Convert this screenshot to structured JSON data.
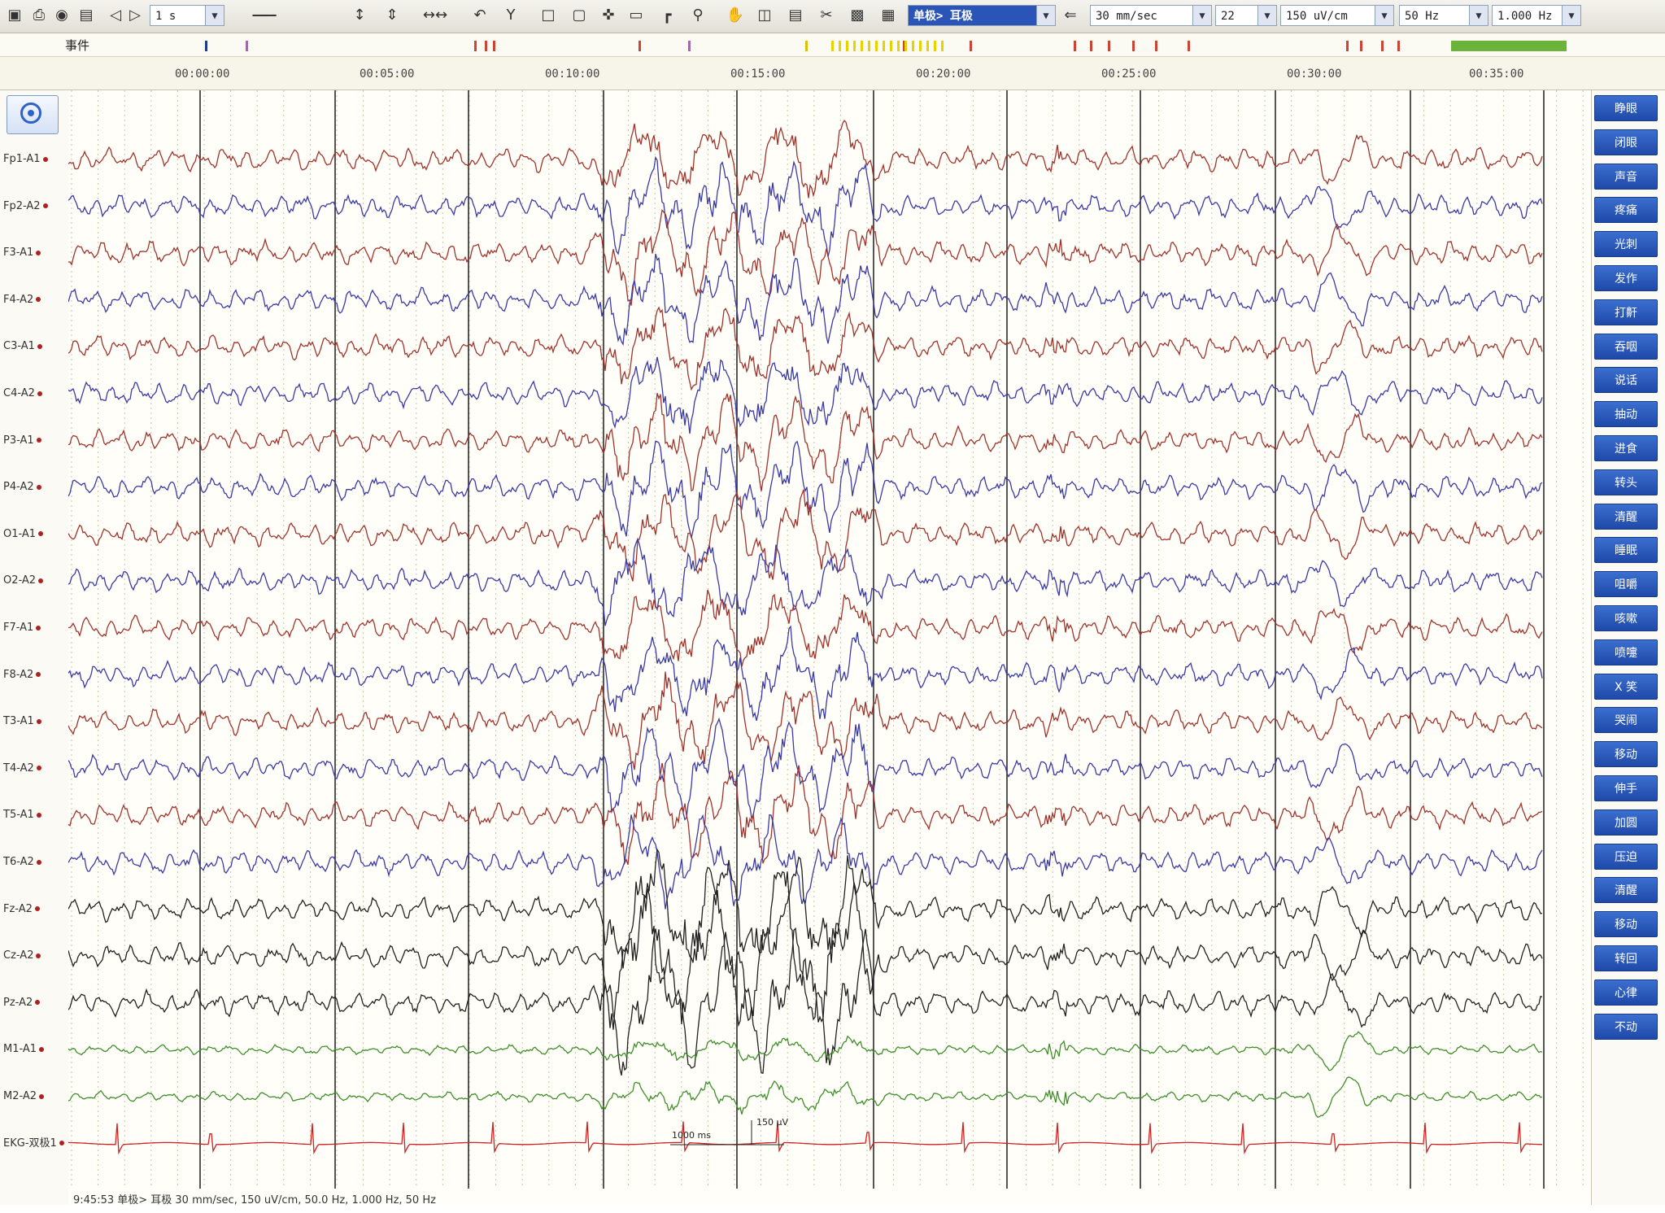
{
  "toolbar": {
    "icons": [
      "save-icon",
      "print-icon",
      "camera-icon",
      "archive-icon",
      "step-back-icon",
      "step-forward-icon",
      "zoom-slider-icon",
      "split-vertical-icon",
      "split-double-icon",
      "arrows-horizontal-icon",
      "undo-icon",
      "filter-y-icon",
      "select-icon",
      "box-icon",
      "crosshair-icon",
      "rect-icon",
      "corner-icon",
      "magnifier-icon",
      "hand-icon",
      "columns-icon",
      "rows-icon",
      "cut-icon",
      "image-icon",
      "window-icon"
    ],
    "page_value": "1 s",
    "montage": "单极> 耳极",
    "speed": "30 mm/sec",
    "channels": "22",
    "sensitivity": "150 uV/cm",
    "hf_filter": "50 Hz",
    "tc": "1.000 Hz"
  },
  "event_bar": {
    "label": "事件"
  },
  "timeline": {
    "ticks": [
      "00:00:00",
      "00:05:00",
      "00:10:00",
      "00:15:00",
      "00:20:00",
      "00:25:00",
      "00:30:00",
      "00:35:00"
    ]
  },
  "channels": [
    {
      "label": "Fp1-A1",
      "color": "#a0342c"
    },
    {
      "label": "Fp2-A2",
      "color": "#3a3aa8"
    },
    {
      "label": "F3-A1",
      "color": "#a0342c"
    },
    {
      "label": "F4-A2",
      "color": "#3a3aa8"
    },
    {
      "label": "C3-A1",
      "color": "#a0342c"
    },
    {
      "label": "C4-A2",
      "color": "#3a3aa8"
    },
    {
      "label": "P3-A1",
      "color": "#a0342c"
    },
    {
      "label": "P4-A2",
      "color": "#3a3aa8"
    },
    {
      "label": "O1-A1",
      "color": "#a0342c"
    },
    {
      "label": "O2-A2",
      "color": "#3a3aa8"
    },
    {
      "label": "F7-A1",
      "color": "#a0342c"
    },
    {
      "label": "F8-A2",
      "color": "#3a3aa8"
    },
    {
      "label": "T3-A1",
      "color": "#a0342c"
    },
    {
      "label": "T4-A2",
      "color": "#3a3aa8"
    },
    {
      "label": "T5-A1",
      "color": "#a0342c"
    },
    {
      "label": "T6-A2",
      "color": "#3a3aa8"
    },
    {
      "label": "Fz-A2",
      "color": "#222222"
    },
    {
      "label": "Cz-A2",
      "color": "#222222"
    },
    {
      "label": "Pz-A2",
      "color": "#222222"
    },
    {
      "label": "M1-A1",
      "color": "#3f8f2a"
    },
    {
      "label": "M2-A2",
      "color": "#3f8f2a"
    },
    {
      "label": "EKG-双极1",
      "color": "#d02020"
    }
  ],
  "event_buttons": [
    "睁眼",
    "闭眼",
    "声音",
    "疼痛",
    "光刺",
    "发作",
    "打鼾",
    "吞咽",
    "说话",
    "抽动",
    "进食",
    "转头",
    "清醒",
    "睡眠",
    "咀嚼",
    "咳嗽",
    "喷嚏",
    "X 笑",
    "哭闹",
    "移动",
    "伸手",
    "加圆",
    "压迫",
    "清醒",
    "移动",
    "转回",
    "心律",
    "不动"
  ],
  "scale_marker": {
    "time": "1000 ms",
    "amp": "150 µV"
  },
  "status": "9:45:53 单极> 耳极  30 mm/sec, 150 uV/cm, 50.0 Hz, 1.000 Hz, 50 Hz",
  "colors": {
    "grid_major": "#2a2a2a",
    "grid_minor": "#c9c5aa",
    "eeg_red": "#a0342c",
    "eeg_blue": "#3a3aa8",
    "eeg_black": "#222222",
    "eeg_green": "#3f8f2a",
    "ekg": "#d02020",
    "event_button": "#2850b0",
    "activity_green": "#6cb33a"
  }
}
